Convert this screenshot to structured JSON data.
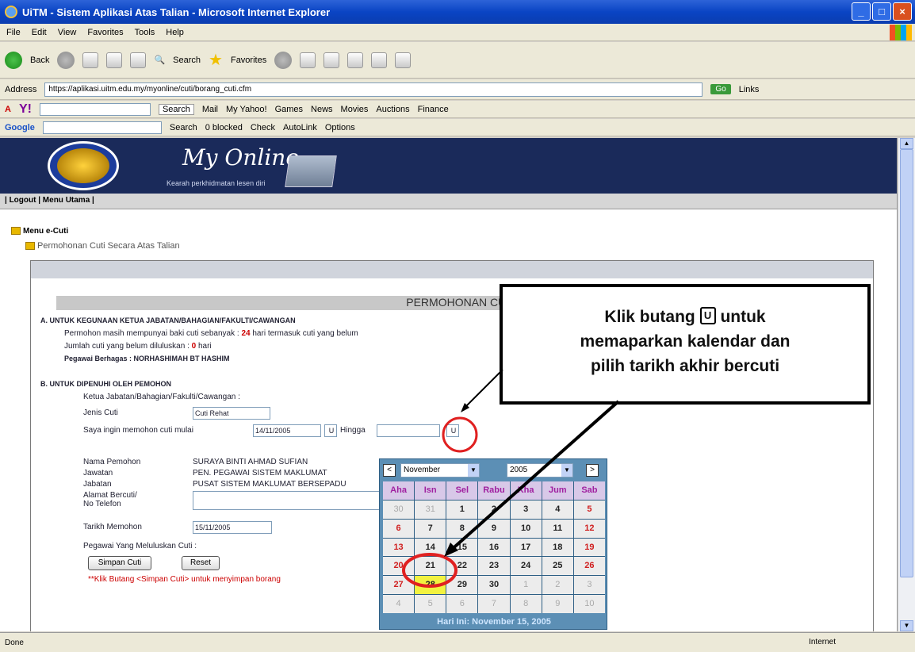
{
  "window": {
    "title": "UiTM - Sistem Aplikasi Atas Talian - Microsoft Internet Explorer"
  },
  "menu": [
    "File",
    "Edit",
    "View",
    "Favorites",
    "Tools",
    "Help"
  ],
  "nav": {
    "back": "Back",
    "search": "Search",
    "favorites": "Favorites"
  },
  "address": {
    "label": "Address",
    "url": "https://aplikasi.uitm.edu.my/myonline/cuti/borang_cuti.cfm",
    "go": "Go",
    "links": "Links"
  },
  "links": [
    "Y!",
    "Search",
    "Mail",
    "My Yahoo!",
    "Games",
    "News",
    "Movies",
    "Auctions",
    "Finance"
  ],
  "google": {
    "label": "Google",
    "search": "Search",
    "blocked": "0 blocked",
    "check": "Check",
    "autolink": "AutoLink",
    "options": "Options"
  },
  "banner": {
    "brand": "My Online",
    "slogan": "Kearah perkhidmatan lesen diri"
  },
  "topnav": "| Logout | Menu Utama |",
  "tree": {
    "root": "Menu e-Cuti",
    "item": "Permohonan Cuti Secara Atas Talian"
  },
  "form": {
    "title": "PERMOHONAN CUTI REHAT",
    "section_a": "A. UNTUK KEGUNAAN KETUA JABATAN/BAHAGIAN/FAKULTI/CAWANGAN",
    "a_line1_pre": "Permohon masih mempunyai baki cuti sebanyak :",
    "a_days": "24",
    "a_line1_post": "hari termasuk cuti yang belum",
    "a_line2_pre": "Jumlah cuti yang belum diluluskan :",
    "a_pending": "0",
    "a_line2_post": "hari",
    "a_line3": "Pegawai Berhagas : NORHASHIMAH BT HASHIM",
    "section_b": "B. UNTUK DIPENUHI OLEH PEMOHON",
    "head_label": "Ketua Jabatan/Bahagian/Fakulti/Cawangan :",
    "leave_type_label": "Jenis Cuti",
    "leave_type_value": "Cuti Rehat",
    "start_label": "Saya ingin memohon cuti mulai",
    "start_value": "14/11/2005",
    "until": "Hingga",
    "name_label": "Nama Pemohon",
    "name_value": "SURAYA BINTI AHMAD SUFIAN",
    "position_label": "Jawatan",
    "position_value": "PEN. PEGAWAI SISTEM MAKLUMAT",
    "dept_label": "Jabatan",
    "dept_value": "PUSAT SISTEM MAKLUMAT BERSEPADU",
    "addr_label": "Alamat Bercuti/ No Telefon",
    "date_label": "Tarikh Memohon",
    "date_value": "15/11/2005",
    "approver_label": "Pegawai Yang Meluluskan Cuti :",
    "submit": "Simpan Cuti",
    "reset": "Reset",
    "note": "**Klik Butang <Simpan Cuti> untuk menyimpan borang"
  },
  "callout": {
    "line1_pre": "Klik butang",
    "icon": "U",
    "line1_post": "untuk",
    "line2": "memaparkan kalendar dan",
    "line3": "pilih tarikh akhir bercuti"
  },
  "calendar": {
    "month": "November",
    "year": "2005",
    "prev": "<",
    "next": ">",
    "days": [
      "Aha",
      "Isn",
      "Sel",
      "Rabu",
      "Kha",
      "Jum",
      "Sab"
    ],
    "weeks": [
      [
        {
          "d": "30",
          "o": true
        },
        {
          "d": "31",
          "o": true
        },
        {
          "d": "1"
        },
        {
          "d": "2"
        },
        {
          "d": "3"
        },
        {
          "d": "4"
        },
        {
          "d": "5",
          "w": true
        }
      ],
      [
        {
          "d": "6",
          "w": true
        },
        {
          "d": "7"
        },
        {
          "d": "8"
        },
        {
          "d": "9"
        },
        {
          "d": "10"
        },
        {
          "d": "11"
        },
        {
          "d": "12",
          "w": true
        }
      ],
      [
        {
          "d": "13",
          "w": true
        },
        {
          "d": "14"
        },
        {
          "d": "15"
        },
        {
          "d": "16"
        },
        {
          "d": "17"
        },
        {
          "d": "18"
        },
        {
          "d": "19",
          "w": true
        }
      ],
      [
        {
          "d": "20",
          "w": true
        },
        {
          "d": "21"
        },
        {
          "d": "22"
        },
        {
          "d": "23"
        },
        {
          "d": "24"
        },
        {
          "d": "25"
        },
        {
          "d": "26",
          "w": true
        }
      ],
      [
        {
          "d": "27",
          "w": true
        },
        {
          "d": "28",
          "t": true
        },
        {
          "d": "29"
        },
        {
          "d": "30"
        },
        {
          "d": "1",
          "o": true
        },
        {
          "d": "2",
          "o": true
        },
        {
          "d": "3",
          "o": true
        }
      ],
      [
        {
          "d": "4",
          "o": true
        },
        {
          "d": "5",
          "o": true
        },
        {
          "d": "6",
          "o": true
        },
        {
          "d": "7",
          "o": true
        },
        {
          "d": "8",
          "o": true
        },
        {
          "d": "9",
          "o": true
        },
        {
          "d": "10",
          "o": true
        }
      ]
    ],
    "today": "Hari Ini: November 15, 2005"
  },
  "status": {
    "left": "Done",
    "zone": "Internet"
  }
}
